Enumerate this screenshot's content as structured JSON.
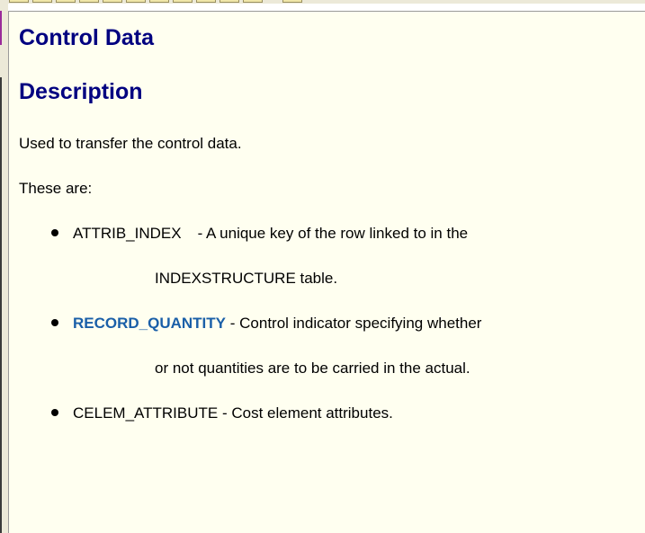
{
  "document": {
    "title": "Control Data",
    "section_heading": "Description",
    "intro": "Used to transfer the control data.",
    "list_intro": "These are:",
    "items": [
      {
        "field": "ATTRIB_INDEX",
        "description": "- A unique key of the row linked to in the",
        "continuation": "INDEXSTRUCTURE table.",
        "is_link": false
      },
      {
        "field": "RECORD_QUANTITY",
        "description": "- Control indicator specifying whether",
        "continuation": "or not quantities are to be carried in the actual.",
        "is_link": true
      },
      {
        "field": "CELEM_ATTRIBUTE",
        "description": "- Cost element attributes.",
        "is_link": false
      }
    ]
  },
  "colors": {
    "heading": "#000080",
    "link": "#1a5fa8",
    "background": "#fffff0"
  }
}
